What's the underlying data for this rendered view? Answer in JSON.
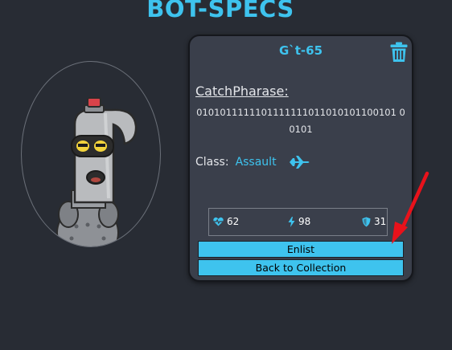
{
  "page": {
    "title": "BOT-SPECS"
  },
  "bot": {
    "name": "G`t-65",
    "catchphrase_label": "CatchPharase:",
    "catchphrase": "0101011111101111111011010101100101 00101",
    "class_label": "Class:",
    "class_value": "Assault",
    "class_icon": "fighter-jet-icon",
    "avatar_icon": "robot-avatar"
  },
  "stats": {
    "health": "62",
    "damage": "98",
    "armor": "31",
    "health_icon": "heartbeat-icon",
    "damage_icon": "bolt-icon",
    "armor_icon": "shield-icon"
  },
  "actions": {
    "enlist_label": "Enlist",
    "back_label": "Back to Collection",
    "delete_icon": "trash-icon"
  },
  "annotation": {
    "arrow_color": "#e8121b",
    "arrow_icon": "red-arrow-annotation"
  },
  "colors": {
    "background": "#282c34",
    "accent": "#3ec3ee",
    "card": "#3a3f4b"
  }
}
